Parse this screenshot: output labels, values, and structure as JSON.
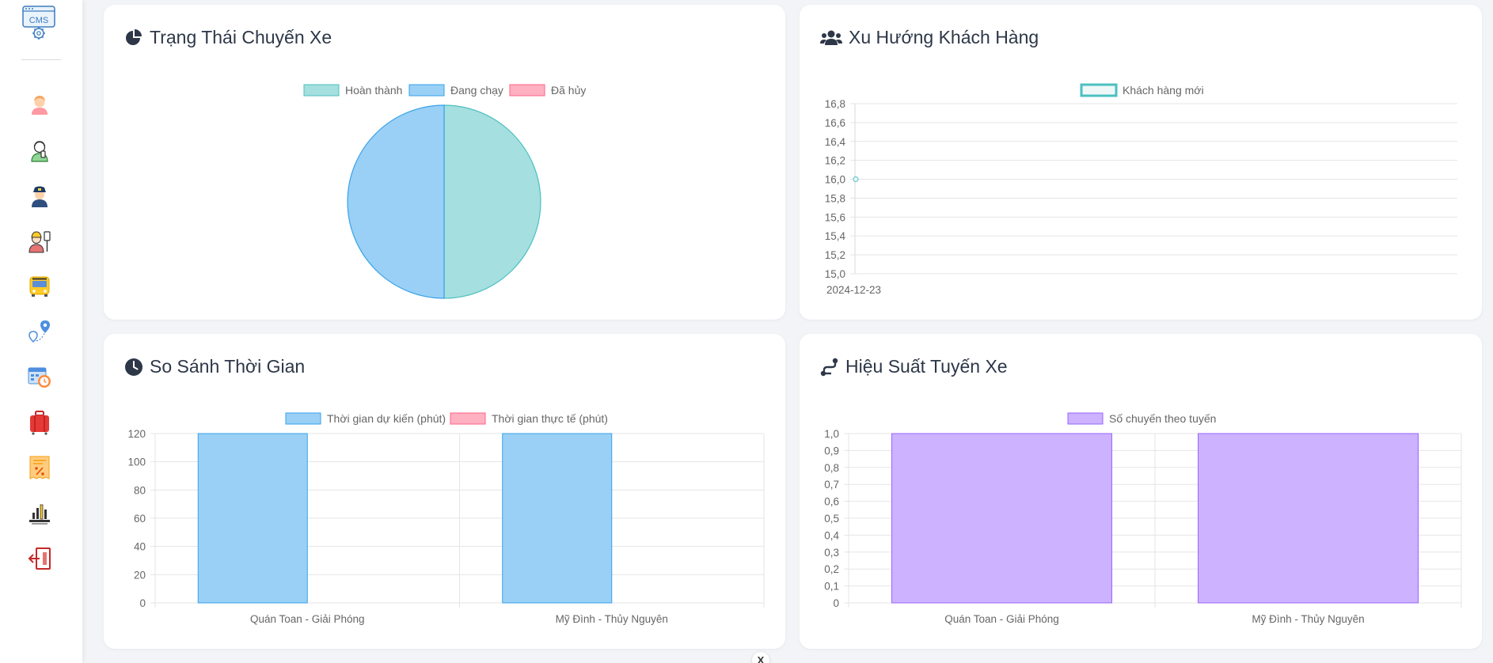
{
  "sidebar": {
    "logo_text": "CMS",
    "items": [
      {
        "icon": "user-admin-icon"
      },
      {
        "icon": "customer-icon"
      },
      {
        "icon": "driver-icon"
      },
      {
        "icon": "staff-icon"
      },
      {
        "icon": "bus-icon"
      },
      {
        "icon": "route-map-icon"
      },
      {
        "icon": "schedule-icon"
      },
      {
        "icon": "luggage-icon"
      },
      {
        "icon": "discount-icon"
      },
      {
        "icon": "statistics-icon"
      },
      {
        "icon": "logout-icon"
      }
    ]
  },
  "cards": {
    "trip_status": {
      "title": "Trạng Thái Chuyến Xe",
      "chart_data": {
        "type": "pie",
        "labels": [
          "Hoàn thành",
          "Đang chạy",
          "Đã hủy"
        ],
        "values": [
          1,
          1,
          0
        ],
        "colors": [
          "#a6dfdf",
          "#9ad0f5",
          "#ffb1c1"
        ],
        "border_colors": [
          "#4bc0c0",
          "#36a2eb",
          "#ff6384"
        ],
        "legend": "top"
      }
    },
    "customer_trend": {
      "title": "Xu Hướng Khách Hàng",
      "chart_data": {
        "type": "line",
        "x": [
          "2024-12-23"
        ],
        "series": [
          {
            "name": "Khách hàng mới",
            "values": [
              16
            ],
            "color": "#4bc0c0"
          }
        ],
        "ylim": [
          15,
          16.8
        ],
        "yticks": [
          "16,8",
          "16,6",
          "16,4",
          "16,2",
          "16,0",
          "15,8",
          "15,6",
          "15,4",
          "15,2",
          "15,0"
        ],
        "grid": true,
        "legend": "top"
      }
    },
    "time_compare": {
      "title": "So Sánh Thời Gian",
      "chart_data": {
        "type": "bar",
        "categories": [
          "Quán Toan - Giải Phóng",
          "Mỹ Đình - Thủy Nguyên"
        ],
        "series": [
          {
            "name": "Thời gian dự kiến (phút)",
            "values": [
              120,
              120
            ],
            "color": "#9ad0f5",
            "border": "#36a2eb"
          },
          {
            "name": "Thời gian thực tế (phút)",
            "values": [
              0,
              0
            ],
            "color": "#ffb1c1",
            "border": "#ff6384"
          }
        ],
        "ylim": [
          0,
          120
        ],
        "yticks": [
          "120",
          "100",
          "80",
          "60",
          "40",
          "20",
          "0"
        ],
        "grid": true,
        "legend": "top"
      }
    },
    "route_performance": {
      "title": "Hiệu Suất Tuyến Xe",
      "chart_data": {
        "type": "bar",
        "categories": [
          "Quán Toan - Giải Phóng",
          "Mỹ Đình - Thủy Nguyên"
        ],
        "series": [
          {
            "name": "Số chuyến theo tuyến",
            "values": [
              1,
              1
            ],
            "color": "#ccb2ff",
            "border": "#9966ff"
          }
        ],
        "ylim": [
          0,
          1
        ],
        "yticks": [
          "1,0",
          "0,9",
          "0,8",
          "0,7",
          "0,6",
          "0,5",
          "0,4",
          "0,3",
          "0,2",
          "0,1",
          "0"
        ],
        "grid": true,
        "legend": "top"
      }
    }
  },
  "scroll_top_label": "X"
}
